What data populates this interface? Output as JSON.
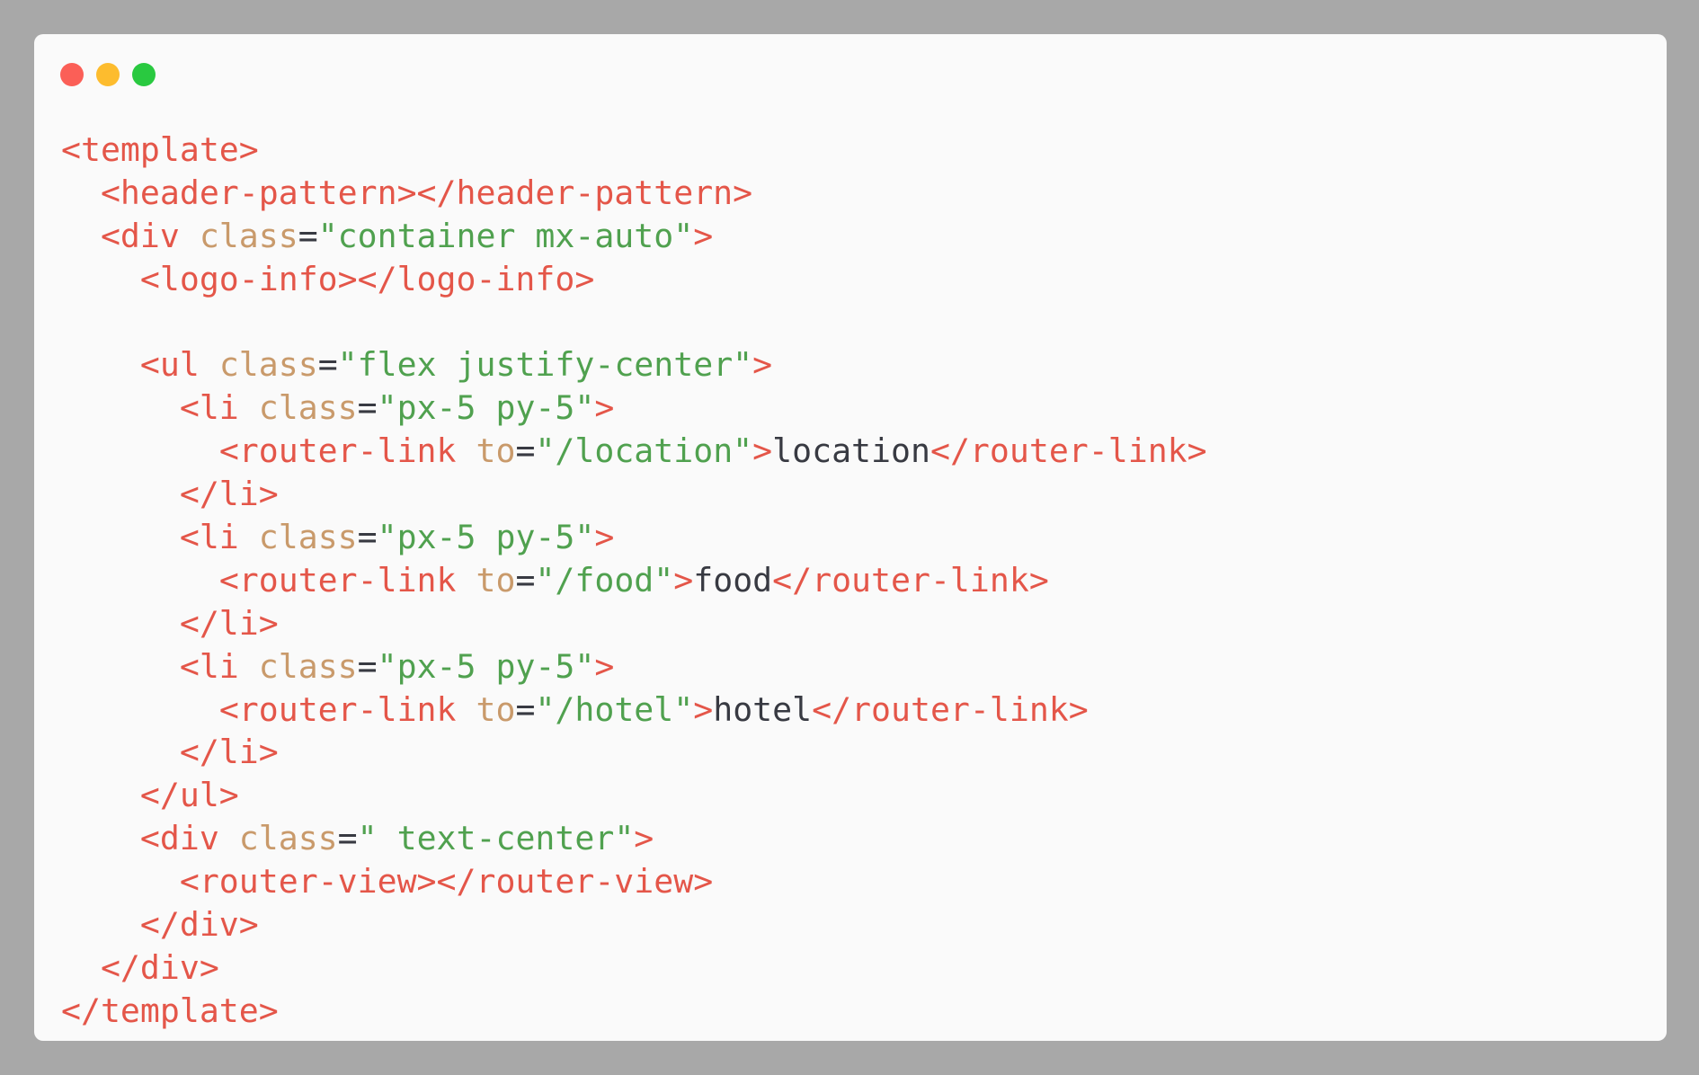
{
  "window": {
    "controls": {
      "close_color": "#fb5f57",
      "minimize_color": "#fdbc2e",
      "zoom_color": "#29c940"
    }
  },
  "colors": {
    "background": "#a8a8a8",
    "panel": "#fafafa",
    "tag": "#e45649",
    "attribute": "#c99a6b",
    "string": "#50a14f",
    "text": "#383a42"
  },
  "code": {
    "lines": [
      [
        [
          "tag",
          "<template>"
        ]
      ],
      [
        [
          "plain",
          "  "
        ],
        [
          "tag",
          "<header-pattern></header-pattern>"
        ]
      ],
      [
        [
          "plain",
          "  "
        ],
        [
          "tag",
          "<div "
        ],
        [
          "attr",
          "class"
        ],
        [
          "punct",
          "="
        ],
        [
          "str",
          "\"container mx-auto\""
        ],
        [
          "tag",
          ">"
        ]
      ],
      [
        [
          "plain",
          "    "
        ],
        [
          "tag",
          "<logo-info></logo-info>"
        ]
      ],
      [
        [
          "plain",
          ""
        ]
      ],
      [
        [
          "plain",
          "    "
        ],
        [
          "tag",
          "<ul "
        ],
        [
          "attr",
          "class"
        ],
        [
          "punct",
          "="
        ],
        [
          "str",
          "\"flex justify-center\""
        ],
        [
          "tag",
          ">"
        ]
      ],
      [
        [
          "plain",
          "      "
        ],
        [
          "tag",
          "<li "
        ],
        [
          "attr",
          "class"
        ],
        [
          "punct",
          "="
        ],
        [
          "str",
          "\"px-5 py-5\""
        ],
        [
          "tag",
          ">"
        ]
      ],
      [
        [
          "plain",
          "        "
        ],
        [
          "tag",
          "<router-link "
        ],
        [
          "attr",
          "to"
        ],
        [
          "punct",
          "="
        ],
        [
          "str",
          "\"/location\""
        ],
        [
          "tag",
          ">"
        ],
        [
          "text",
          "location"
        ],
        [
          "tag",
          "</router-link>"
        ]
      ],
      [
        [
          "plain",
          "      "
        ],
        [
          "tag",
          "</li>"
        ]
      ],
      [
        [
          "plain",
          "      "
        ],
        [
          "tag",
          "<li "
        ],
        [
          "attr",
          "class"
        ],
        [
          "punct",
          "="
        ],
        [
          "str",
          "\"px-5 py-5\""
        ],
        [
          "tag",
          ">"
        ]
      ],
      [
        [
          "plain",
          "        "
        ],
        [
          "tag",
          "<router-link "
        ],
        [
          "attr",
          "to"
        ],
        [
          "punct",
          "="
        ],
        [
          "str",
          "\"/food\""
        ],
        [
          "tag",
          ">"
        ],
        [
          "text",
          "food"
        ],
        [
          "tag",
          "</router-link>"
        ]
      ],
      [
        [
          "plain",
          "      "
        ],
        [
          "tag",
          "</li>"
        ]
      ],
      [
        [
          "plain",
          "      "
        ],
        [
          "tag",
          "<li "
        ],
        [
          "attr",
          "class"
        ],
        [
          "punct",
          "="
        ],
        [
          "str",
          "\"px-5 py-5\""
        ],
        [
          "tag",
          ">"
        ]
      ],
      [
        [
          "plain",
          "        "
        ],
        [
          "tag",
          "<router-link "
        ],
        [
          "attr",
          "to"
        ],
        [
          "punct",
          "="
        ],
        [
          "str",
          "\"/hotel\""
        ],
        [
          "tag",
          ">"
        ],
        [
          "text",
          "hotel"
        ],
        [
          "tag",
          "</router-link>"
        ]
      ],
      [
        [
          "plain",
          "      "
        ],
        [
          "tag",
          "</li>"
        ]
      ],
      [
        [
          "plain",
          "    "
        ],
        [
          "tag",
          "</ul>"
        ]
      ],
      [
        [
          "plain",
          "    "
        ],
        [
          "tag",
          "<div "
        ],
        [
          "attr",
          "class"
        ],
        [
          "punct",
          "="
        ],
        [
          "str",
          "\" text-center\""
        ],
        [
          "tag",
          ">"
        ]
      ],
      [
        [
          "plain",
          "      "
        ],
        [
          "tag",
          "<router-view></router-view>"
        ]
      ],
      [
        [
          "plain",
          "    "
        ],
        [
          "tag",
          "</div>"
        ]
      ],
      [
        [
          "plain",
          "  "
        ],
        [
          "tag",
          "</div>"
        ]
      ],
      [
        [
          "tag",
          "</template>"
        ]
      ]
    ]
  }
}
